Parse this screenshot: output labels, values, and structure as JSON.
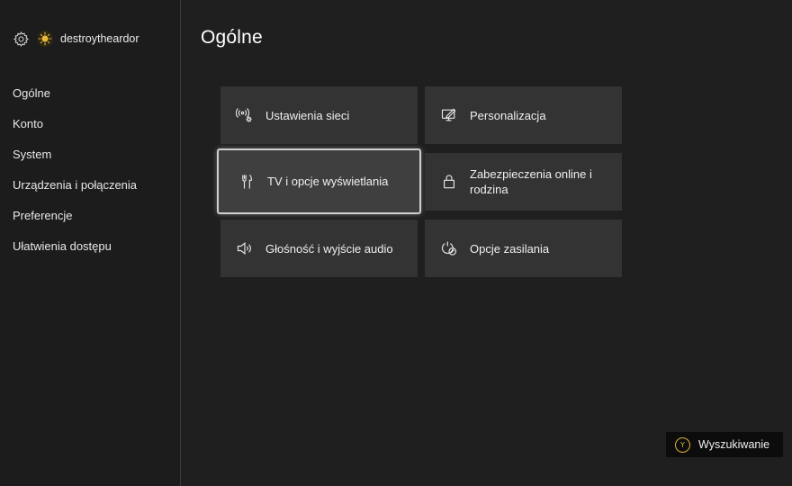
{
  "profile": {
    "gear_icon": "gear-icon",
    "gamertag": "destroytheardor"
  },
  "sidebar": {
    "items": [
      {
        "label": "Ogólne"
      },
      {
        "label": "Konto"
      },
      {
        "label": "System"
      },
      {
        "label": "Urządzenia i połączenia"
      },
      {
        "label": "Preferencje"
      },
      {
        "label": "Ułatwienia dostępu"
      }
    ]
  },
  "main": {
    "title": "Ogólne",
    "tiles": [
      {
        "label": "Ustawienia sieci",
        "icon": "network-settings-icon"
      },
      {
        "label": "Personalizacja",
        "icon": "personalization-icon"
      },
      {
        "label": "TV i opcje wyświetlania",
        "icon": "tv-display-icon",
        "focused": true
      },
      {
        "label": "Zabezpieczenia online i rodzina",
        "icon": "lock-icon"
      },
      {
        "label": "Głośność i wyjście audio",
        "icon": "speaker-icon"
      },
      {
        "label": "Opcje zasilania",
        "icon": "power-icon"
      }
    ]
  },
  "search": {
    "button_glyph": "Y",
    "label": "Wyszukiwanie"
  },
  "colors": {
    "background": "#1f1f1f",
    "tile": "#333333",
    "focus_border": "#cfcfcf",
    "y_button": "#e0b13a"
  }
}
